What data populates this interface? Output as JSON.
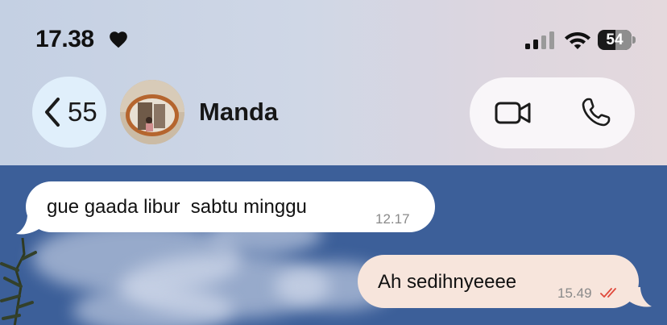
{
  "status_bar": {
    "time": "17.38",
    "battery_level": "54",
    "icons": [
      "heart-icon",
      "signal-icon",
      "wifi-icon",
      "battery-icon"
    ]
  },
  "header": {
    "back_count": "55",
    "contact_name": "Manda",
    "icons": [
      "chevron-left-icon",
      "video-call-icon",
      "phone-icon"
    ]
  },
  "messages": [
    {
      "direction": "incoming",
      "text": "gue gaada libur  sabtu minggu",
      "time": "12.17"
    },
    {
      "direction": "outgoing",
      "text": "Ah sedihnyeeee",
      "time": "15.49",
      "status": "read"
    }
  ],
  "colors": {
    "incoming_bubble": "#ffffff",
    "outgoing_bubble": "#f7e5dc",
    "read_ticks": "#e0493c",
    "wallpaper_sky": "#3c5f99"
  }
}
